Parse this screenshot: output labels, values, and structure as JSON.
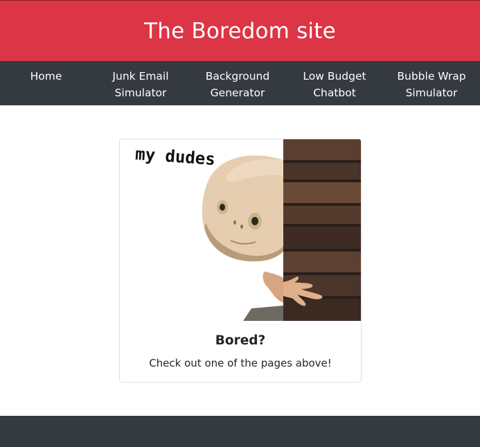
{
  "site": {
    "title": "The Boredom site"
  },
  "nav": {
    "items": [
      {
        "label": "Home"
      },
      {
        "label": "Junk Email\nSimulator"
      },
      {
        "label": "Background\nGenerator"
      },
      {
        "label": "Low Budget\nChatbot"
      },
      {
        "label": "Bubble Wrap\nSimulator"
      }
    ]
  },
  "card": {
    "image_caption": "my dudes",
    "title": "Bored?",
    "text": "Check out one of the pages above!"
  },
  "colors": {
    "header_bg": "#dc3545",
    "nav_bg": "#343a40",
    "footer_bg": "#343a40",
    "text": "#212529"
  }
}
